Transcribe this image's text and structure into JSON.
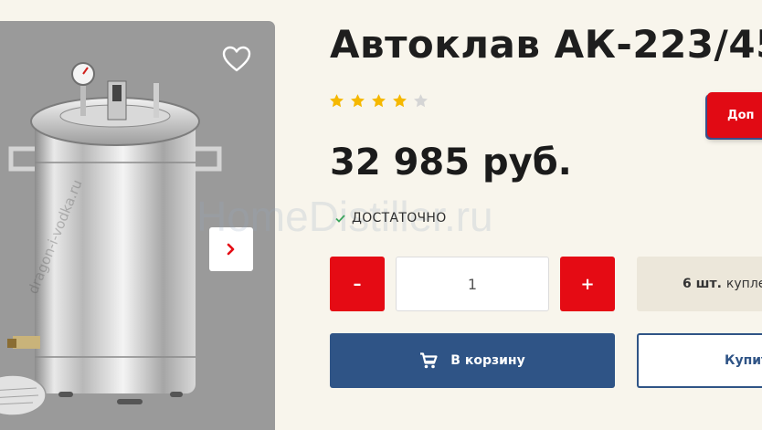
{
  "product": {
    "title": "Автоклав АК-223/45",
    "rating_stars": 4,
    "rating_max": 5,
    "price": "32 985 руб.",
    "stock_status": "ДОСТАТОЧНО",
    "watermark": "HomeDistiller.ru",
    "image_watermark": "dragon-i-vodka.ru"
  },
  "actions": {
    "promo_label": "Доп",
    "minus_label": "–",
    "plus_label": "+",
    "quantity": "1",
    "bought_count": "6 шт.",
    "bought_text": "купле",
    "cart_label": "В корзину",
    "buy_one_click_label": "Купит"
  },
  "colors": {
    "background": "#f8f5ec",
    "accent_red": "#e50b14",
    "primary_blue": "#2f5486",
    "star_gold": "#f5b800",
    "star_gray": "#d5d5d5"
  },
  "icons": [
    "heart-icon",
    "chevron-right-icon",
    "star-icon",
    "check-icon",
    "cart-icon"
  ]
}
